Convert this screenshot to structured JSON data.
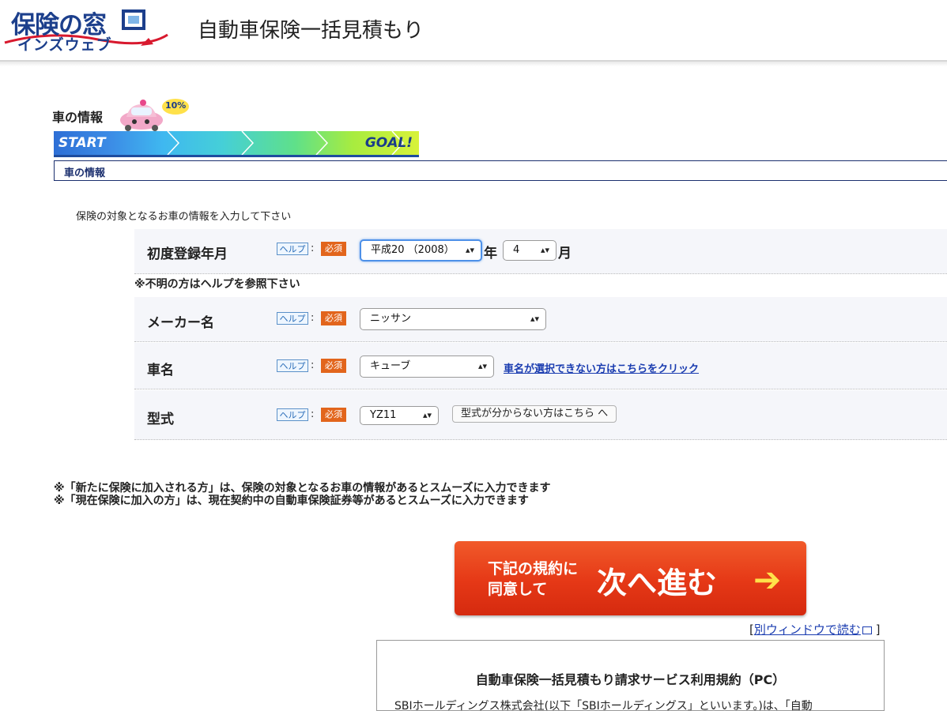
{
  "header": {
    "logo_top": "保険の窓",
    "logo_bottom": "インズウェブ",
    "title": "自動車保険一括見積もり"
  },
  "progress": {
    "section_label": "車の情報",
    "percent_badge": "10%",
    "start_label": "START",
    "goal_label": "GOAL!",
    "completion": 0.1
  },
  "tab": {
    "label": "車の情報"
  },
  "instruction": "保険の対象となるお車の情報を入力して下さい",
  "form": {
    "help_label": "ヘルプ",
    "required_label": "必須",
    "registration": {
      "label": "初度登録年月",
      "year_value": "平成20 （2008）",
      "year_unit": "年",
      "month_value": "4",
      "month_unit": "月",
      "note": "※不明の方はヘルプを参照下さい"
    },
    "maker": {
      "label": "メーカー名",
      "value": "ニッサン"
    },
    "car_name": {
      "label": "車名",
      "value": "キューブ",
      "link": "車名が選択できない方はこちらをクリック"
    },
    "model": {
      "label": "型式",
      "value": "YZ11",
      "button": "型式が分からない方はこちら へ"
    }
  },
  "notes": [
    "※「新たに保険に加入される方」は、保険の対象となるお車の情報があるとスムーズに入力できます",
    "※「現在保険に加入の方」は、現在契約中の自動車保険証券等があるとスムーズに入力できます"
  ],
  "next_button": {
    "small_line1": "下記の規約に",
    "small_line2": "同意して",
    "big": "次へ進む",
    "arrow": "➔"
  },
  "new_window": {
    "open": "[",
    "link": "別ウィンドウで読む",
    "close": "]"
  },
  "terms": {
    "title": "自動車保険一括見積もり請求サービス利用規約（PC）",
    "body": "SBIホールディングス株式会社(以下「SBIホールディングス」といいます。)は、「自動"
  },
  "colors": {
    "brand_blue": "#1c3f8c",
    "required_orange": "#e2651c",
    "next_red": "#e53816",
    "link_blue": "#1a3cb0"
  }
}
